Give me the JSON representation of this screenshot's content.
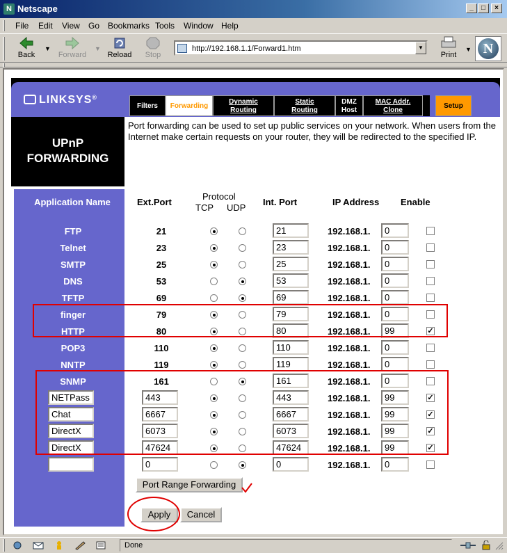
{
  "window": {
    "title": "Netscape"
  },
  "menu": [
    "File",
    "Edit",
    "View",
    "Go",
    "Bookmarks",
    "Tools",
    "Window",
    "Help"
  ],
  "toolbar": {
    "back": "Back",
    "forward": "Forward",
    "reload": "Reload",
    "stop": "Stop",
    "print": "Print"
  },
  "address": {
    "url": "http://192.168.1.1/Forward1.htm"
  },
  "brand": {
    "logo": "LINKSYS"
  },
  "tabs": [
    {
      "label": "Filters"
    },
    {
      "label": "Forwarding"
    },
    {
      "label": "Dynamic Routing"
    },
    {
      "label": "Static Routing"
    },
    {
      "label": "DMZ Host"
    },
    {
      "label": "MAC Addr. Clone"
    },
    {
      "label": "Setup"
    }
  ],
  "section": {
    "title_line1": "UPnP",
    "title_line2": "FORWARDING"
  },
  "description": "Port forwarding can be used to set up public services on your network. When users from the Internet make certain requests on your router, they will be redirected to the specified IP.",
  "table": {
    "headers": {
      "app": "Application Name",
      "ext": "Ext.Port",
      "protocol": "Protocol",
      "tcp": "TCP",
      "udp": "UDP",
      "int": "Int. Port",
      "ip": "IP Address",
      "enable": "Enable"
    },
    "ip_prefix": "192.168.1.",
    "fixed_rows": [
      {
        "name": "FTP",
        "ext": "21",
        "proto": "tcp",
        "int": "21",
        "ip": "0",
        "enabled": false
      },
      {
        "name": "Telnet",
        "ext": "23",
        "proto": "tcp",
        "int": "23",
        "ip": "0",
        "enabled": false
      },
      {
        "name": "SMTP",
        "ext": "25",
        "proto": "tcp",
        "int": "25",
        "ip": "0",
        "enabled": false
      },
      {
        "name": "DNS",
        "ext": "53",
        "proto": "udp",
        "int": "53",
        "ip": "0",
        "enabled": false
      },
      {
        "name": "TFTP",
        "ext": "69",
        "proto": "udp",
        "int": "69",
        "ip": "0",
        "enabled": false
      },
      {
        "name": "finger",
        "ext": "79",
        "proto": "tcp",
        "int": "79",
        "ip": "0",
        "enabled": false
      },
      {
        "name": "HTTP",
        "ext": "80",
        "proto": "tcp",
        "int": "80",
        "ip": "99",
        "enabled": true
      },
      {
        "name": "POP3",
        "ext": "110",
        "proto": "tcp",
        "int": "110",
        "ip": "0",
        "enabled": false
      },
      {
        "name": "NNTP",
        "ext": "119",
        "proto": "tcp",
        "int": "119",
        "ip": "0",
        "enabled": false
      },
      {
        "name": "SNMP",
        "ext": "161",
        "proto": "udp",
        "int": "161",
        "ip": "0",
        "enabled": false
      }
    ],
    "custom_rows": [
      {
        "name": "NETPass",
        "ext": "443",
        "proto": "tcp",
        "int": "443",
        "ip": "99",
        "enabled": true
      },
      {
        "name": "Chat",
        "ext": "6667",
        "proto": "tcp",
        "int": "6667",
        "ip": "99",
        "enabled": true
      },
      {
        "name": "DirectX",
        "ext": "6073",
        "proto": "tcp",
        "int": "6073",
        "ip": "99",
        "enabled": true
      },
      {
        "name": "DirectX",
        "ext": "47624",
        "proto": "tcp",
        "int": "47624",
        "ip": "99",
        "enabled": true
      },
      {
        "name": "",
        "ext": "0",
        "proto": "udp",
        "int": "0",
        "ip": "0",
        "enabled": false
      }
    ]
  },
  "buttons": {
    "port_range": "Port Range Forwarding",
    "apply": "Apply",
    "cancel": "Cancel"
  },
  "status": {
    "text": "Done"
  },
  "colors": {
    "accent": "#6666cc",
    "highlight": "#ff9900",
    "annotation": "#e00000"
  }
}
